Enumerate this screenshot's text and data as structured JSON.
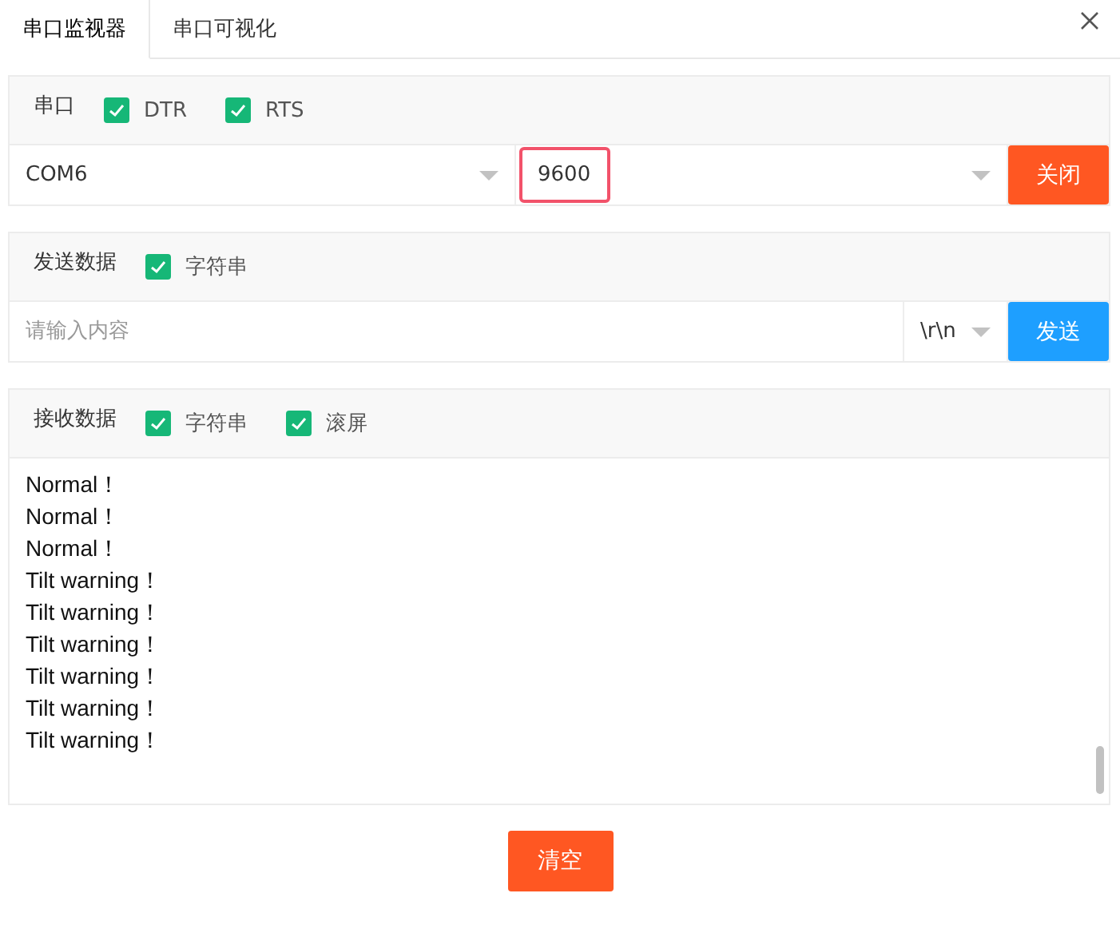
{
  "tabs": [
    {
      "label": "串口监视器",
      "selected": true
    },
    {
      "label": "串口可视化",
      "selected": false
    }
  ],
  "port": {
    "title": "串口",
    "options": [
      {
        "label": "DTR",
        "checked": true
      },
      {
        "label": "RTS",
        "checked": true
      }
    ],
    "port_select": "COM6",
    "baud_select": "9600",
    "baud_highlighted": true,
    "button": "关闭"
  },
  "send": {
    "title": "发送数据",
    "options": [
      {
        "label": "字符串",
        "checked": true
      }
    ],
    "placeholder": "请输入内容",
    "line_ending": "\\r\\n",
    "button": "发送"
  },
  "receive": {
    "title": "接收数据",
    "options": [
      {
        "label": "字符串",
        "checked": true
      },
      {
        "label": "滚屏",
        "checked": true
      }
    ],
    "lines": [
      "Normal！",
      "Normal！",
      "Normal！",
      "Tilt warning！",
      "Tilt warning！",
      "Tilt warning！",
      "Tilt warning！",
      "Tilt warning！",
      "Tilt warning！"
    ]
  },
  "clear_button": "清空"
}
